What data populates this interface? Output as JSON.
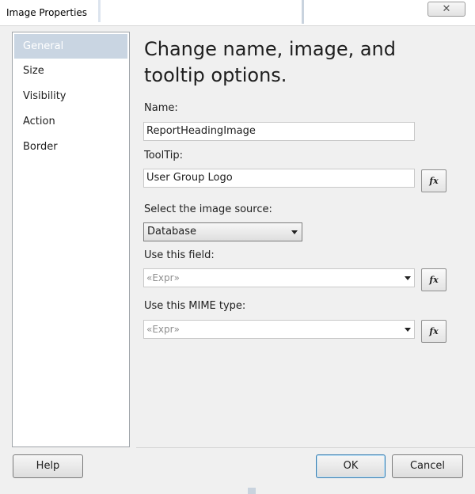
{
  "window": {
    "title": "Image Properties",
    "close_glyph": "✕"
  },
  "sidebar": {
    "items": [
      {
        "label": "General",
        "selected": true
      },
      {
        "label": "Size"
      },
      {
        "label": "Visibility"
      },
      {
        "label": "Action"
      },
      {
        "label": "Border"
      }
    ]
  },
  "main": {
    "heading": "Change name, image, and tooltip options.",
    "name": {
      "label": "Name:",
      "value": "ReportHeadingImage"
    },
    "tooltip": {
      "label": "ToolTip:",
      "value": "User Group Logo"
    },
    "image_source": {
      "label": "Select the image source:",
      "value": "Database"
    },
    "field": {
      "label": "Use this field:",
      "value": "«Expr»"
    },
    "mime": {
      "label": "Use this MIME type:",
      "value": "«Expr»"
    },
    "fx_label": "fx"
  },
  "footer": {
    "help_label": "Help",
    "ok_label": "OK",
    "cancel_label": "Cancel"
  },
  "colors": {
    "selected_item_bg": "#c9d5e2",
    "ok_border": "#3c7fb1"
  }
}
